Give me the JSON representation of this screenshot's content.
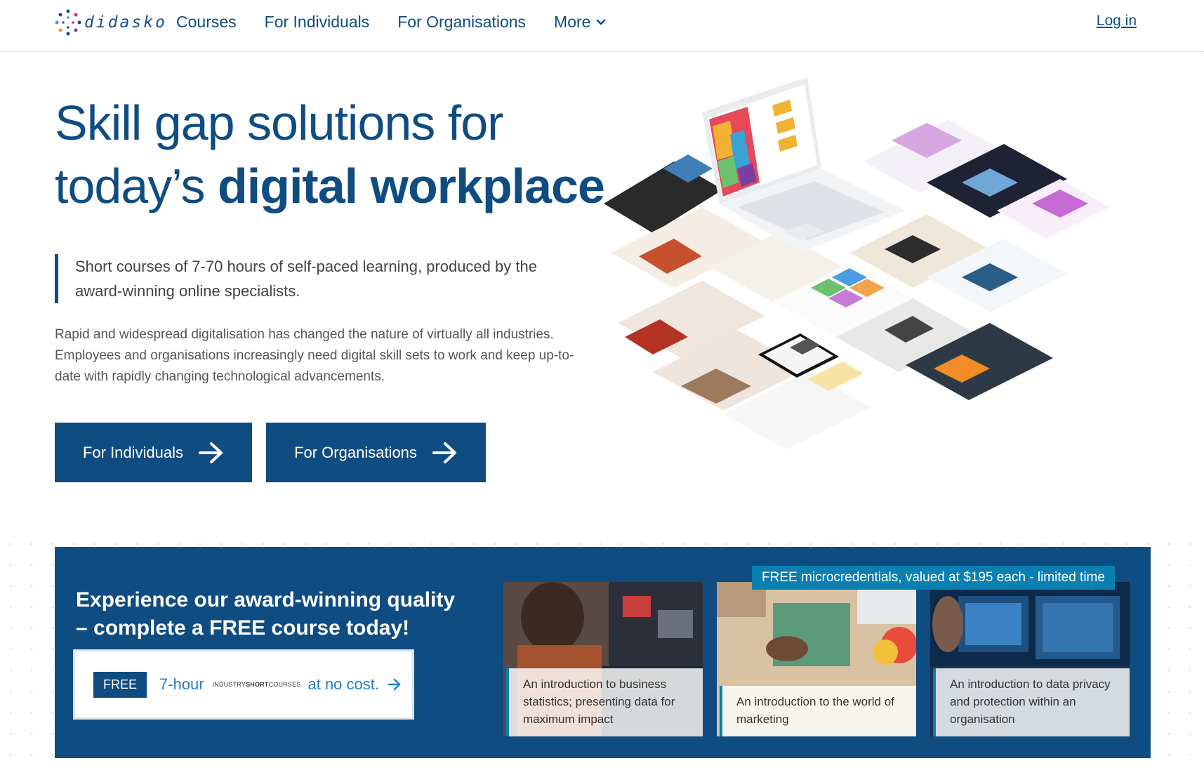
{
  "nav": {
    "logo_text": "didasko",
    "links": [
      "Courses",
      "For Individuals",
      "For Organisations",
      "More"
    ],
    "login": "Log in"
  },
  "hero": {
    "title_line1": "Skill gap solutions for",
    "title_line2_light": "today’s ",
    "title_line2_bold": "digital workplace",
    "quote": "Short courses of 7-70 hours of self-paced learning, produced by the award-winning online specialists.",
    "body": "Rapid and widespread digitalisation has changed the nature of virtually all industries. Employees and organisations increasingly need digital skill sets to work and keep up-to-date with rapidly changing technological advancements.",
    "buttons": [
      "For Individuals",
      "For Organisations"
    ]
  },
  "promo": {
    "title": "Experience our award-winning quality – complete a FREE course today!",
    "card": {
      "badge": "FREE",
      "hours": "7-hour",
      "brand_pre": "INDUSTRY",
      "brand_bold": "SHORT",
      "brand_post": "COURSES",
      "suffix": "at no cost."
    },
    "ribbon": "FREE microcredentials, valued at $195 each - limited time",
    "courses": [
      "An introduction to business statistics; presenting data for maximum impact",
      "An introduction to the world of marketing",
      "An introduction to data privacy and protection within an organisation"
    ]
  },
  "colors": {
    "brand_blue": "#0f4c81",
    "accent_teal": "#0a7fb0",
    "link_blue": "#1f7fc0"
  }
}
